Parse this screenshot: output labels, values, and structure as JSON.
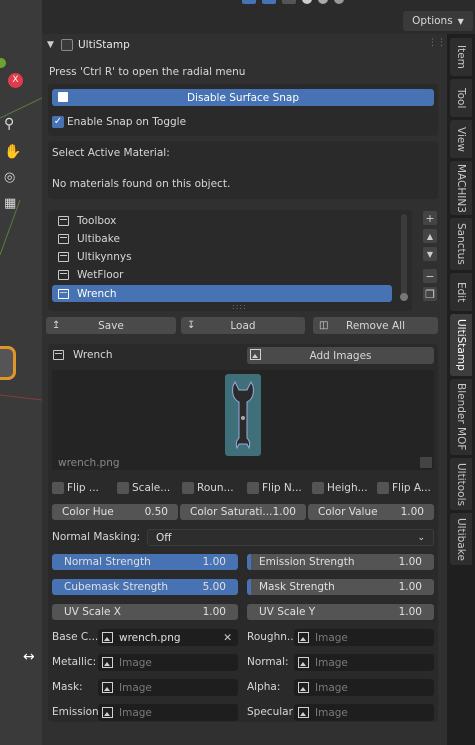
{
  "header": {
    "options_label": "Options"
  },
  "panel": {
    "title": "UltiStamp",
    "hint": "Press 'Ctrl R' to open the radial menu",
    "disable_snap_label": "Disable Surface Snap",
    "enable_snap_label": "Enable Snap on Toggle",
    "enable_snap_checked": true,
    "material_heading": "Select Active Material:",
    "material_message": "No materials found on this object.",
    "list_items": [
      "Toolbox",
      "Ultibake",
      "Ultikynnys",
      "WetFloor",
      "Wrench"
    ],
    "selected_item": "Wrench",
    "save_label": "Save",
    "load_label": "Load",
    "remove_all_label": "Remove All",
    "stamp_name": "Wrench",
    "add_images_label": "Add Images",
    "image_file": "wrench.png",
    "flips": [
      "Flip ...",
      "Scale...",
      "Roun...",
      "Flip N...",
      "Heigh...",
      "Flip A..."
    ],
    "color_hue_label": "Color Hue",
    "color_hue_value": "0.50",
    "color_saturation_label": "Color Saturati...",
    "color_saturation_value": "1.00",
    "color_value_label": "Color Value",
    "color_value_value": "1.00",
    "normal_masking_label": "Normal Masking:",
    "normal_masking_value": "Off",
    "normal_strength_label": "Normal Strength",
    "normal_strength_value": "1.00",
    "emission_strength_label": "Emission Strength",
    "emission_strength_value": "1.00",
    "cubemask_strength_label": "Cubemask Strength",
    "cubemask_strength_value": "5.00",
    "mask_strength_label": "Mask Strength",
    "mask_strength_value": "1.00",
    "uv_scale_x_label": "UV Scale X",
    "uv_scale_x_value": "1.00",
    "uv_scale_y_label": "UV Scale Y",
    "uv_scale_y_value": "1.00",
    "image_slots": {
      "base_color_label": "Base C...",
      "base_color_value": "wrench.png",
      "roughness_label": "Roughn...",
      "metallic_label": "Metallic:",
      "normal_label": "Normal:",
      "mask_label": "Mask:",
      "alpha_label": "Alpha:",
      "emission_label": "Emission:",
      "specular_label": "Specular:",
      "placeholder": "Image"
    }
  },
  "tabs": [
    "Item",
    "Tool",
    "View",
    "MACHIN3",
    "Sanctus",
    "Edit",
    "UltiStamp",
    "Blender MOF",
    "Ultitools",
    "Ultibake"
  ],
  "active_tab": "UltiStamp",
  "colors": {
    "accent": "#4772b3",
    "panel": "#303030",
    "field": "#545454"
  }
}
